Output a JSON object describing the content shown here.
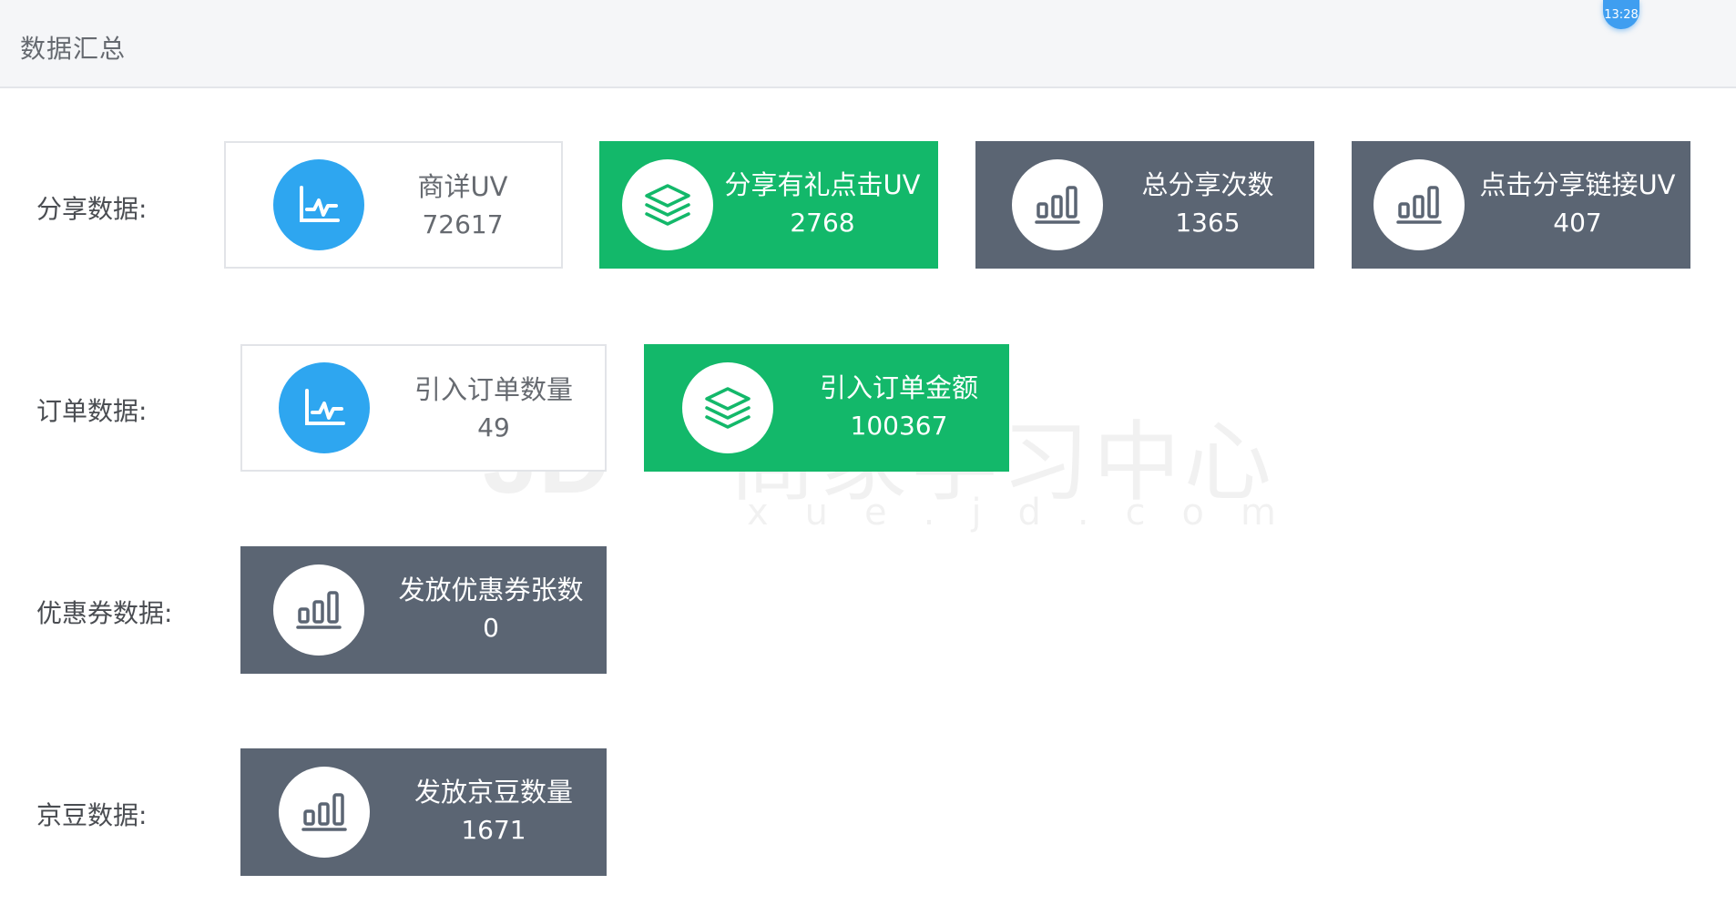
{
  "header": {
    "title": "数据汇总",
    "time": "13:28"
  },
  "watermark": {
    "logo": "JD",
    "text": "商家学习中心",
    "url": "xue.jd.com"
  },
  "rows": {
    "share": {
      "label": "分享数据:",
      "cards": [
        {
          "title": "商详UV",
          "value": "72617",
          "icon": "line-chart-icon",
          "style": "white"
        },
        {
          "title": "分享有礼点击UV",
          "value": "2768",
          "icon": "layers-icon",
          "style": "green"
        },
        {
          "title": "总分享次数",
          "value": "1365",
          "icon": "bar-chart-icon",
          "style": "slate"
        },
        {
          "title": "点击分享链接UV",
          "value": "407",
          "icon": "bar-chart-icon",
          "style": "slate"
        }
      ]
    },
    "order": {
      "label": "订单数据:",
      "cards": [
        {
          "title": "引入订单数量",
          "value": "49",
          "icon": "line-chart-icon",
          "style": "white"
        },
        {
          "title": "引入订单金额",
          "value": "100367",
          "icon": "layers-icon",
          "style": "green"
        }
      ]
    },
    "coupon": {
      "label": "优惠券数据:",
      "cards": [
        {
          "title": "发放优惠券张数",
          "value": "0",
          "icon": "bar-chart-icon",
          "style": "slate"
        }
      ]
    },
    "bean": {
      "label": "京豆数据:",
      "cards": [
        {
          "title": "发放京豆数量",
          "value": "1671",
          "icon": "bar-chart-icon",
          "style": "slate"
        }
      ]
    }
  },
  "colors": {
    "blue": "#2ea6f0",
    "green": "#13b86a",
    "slate": "#5b6573"
  }
}
